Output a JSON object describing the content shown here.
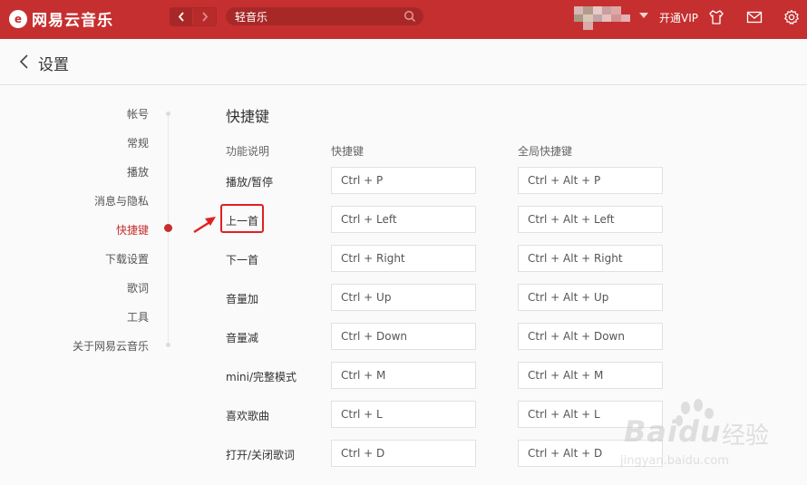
{
  "app": {
    "title": "网易云音乐",
    "logo_glyph": "e"
  },
  "topbar": {
    "search_value": "轻音乐",
    "vip_label": "开通VIP",
    "accent": "#c62f2f"
  },
  "header": {
    "title": "设置"
  },
  "sidebar": {
    "items": [
      {
        "label": "帐号",
        "active": false
      },
      {
        "label": "常规",
        "active": false
      },
      {
        "label": "播放",
        "active": false
      },
      {
        "label": "消息与隐私",
        "active": false
      },
      {
        "label": "快捷键",
        "active": true
      },
      {
        "label": "下载设置",
        "active": false
      },
      {
        "label": "歌词",
        "active": false
      },
      {
        "label": "工具",
        "active": false
      },
      {
        "label": "关于网易云音乐",
        "active": false
      }
    ]
  },
  "shortcuts": {
    "title": "快捷键",
    "columns": [
      "功能说明",
      "快捷键",
      "全局快捷键"
    ],
    "rows": [
      {
        "label": "播放/暂停",
        "key": "Ctrl + P",
        "global": "Ctrl + Alt + P"
      },
      {
        "label": "上一首",
        "key": "Ctrl + Left",
        "global": "Ctrl + Alt + Left"
      },
      {
        "label": "下一首",
        "key": "Ctrl + Right",
        "global": "Ctrl + Alt + Right"
      },
      {
        "label": "音量加",
        "key": "Ctrl + Up",
        "global": "Ctrl + Alt + Up"
      },
      {
        "label": "音量减",
        "key": "Ctrl + Down",
        "global": "Ctrl + Alt + Down"
      },
      {
        "label": "mini/完整模式",
        "key": "Ctrl + M",
        "global": "Ctrl + Alt + M"
      },
      {
        "label": "喜欢歌曲",
        "key": "Ctrl + L",
        "global": "Ctrl + Alt + L"
      },
      {
        "label": "打开/关闭歌词",
        "key": "Ctrl + D",
        "global": "Ctrl + Alt + D"
      }
    ]
  },
  "watermark": {
    "brand": "Baidu",
    "cn": "经验",
    "url": "jingyan.baidu.com"
  }
}
